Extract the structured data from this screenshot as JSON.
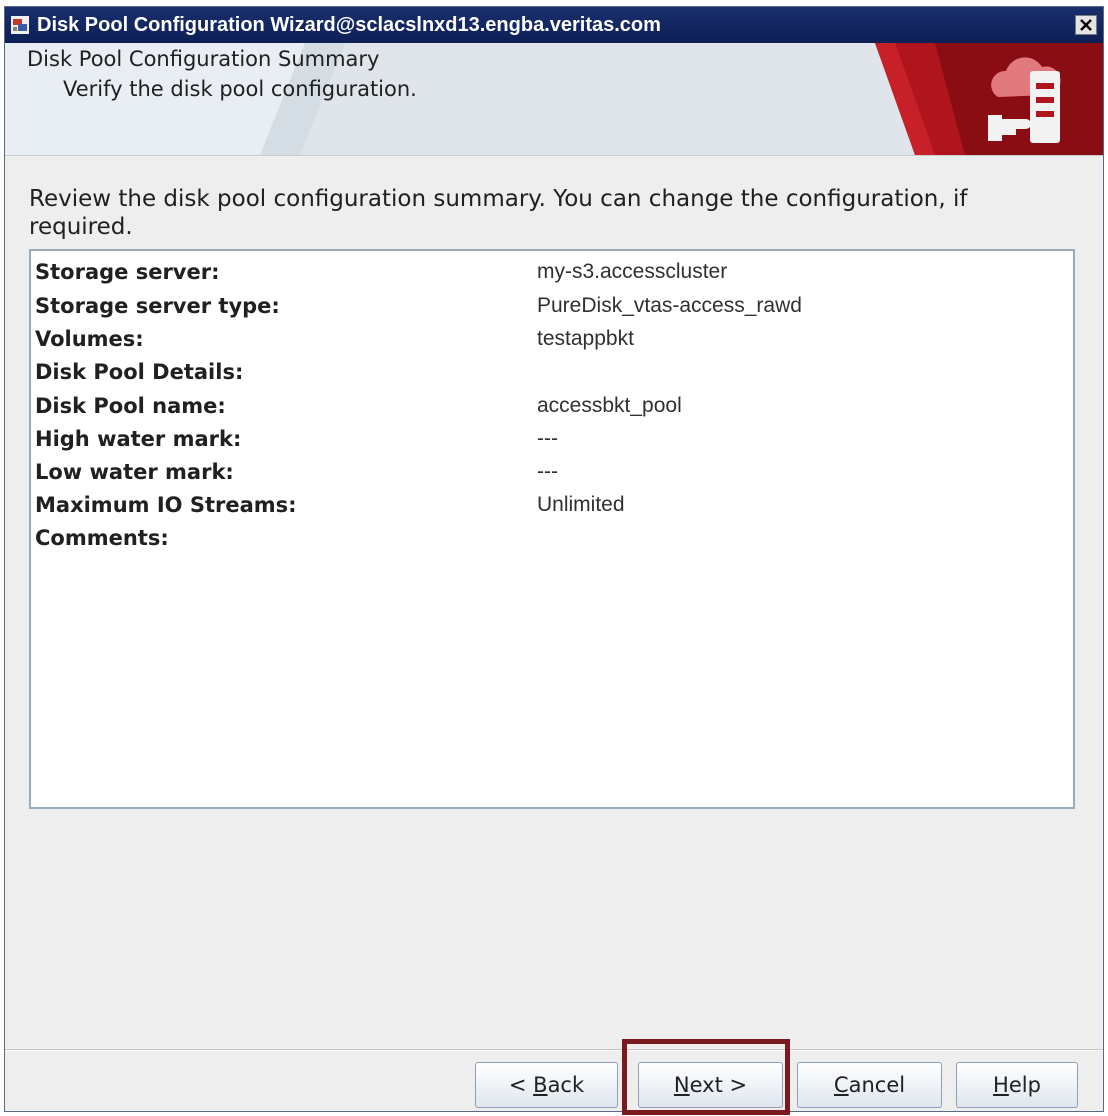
{
  "window": {
    "title": "Disk Pool Configuration Wizard@sclacslnxd13.engba.veritas.com",
    "close_glyph": "✕"
  },
  "header": {
    "title": "Disk Pool Configuration Summary",
    "subtitle": "Verify the disk pool configuration.",
    "brand_color": "#b0141c",
    "logo_icon": "cloud-storage-icon"
  },
  "instructions": "Review the disk pool configuration summary. You can change the configuration, if required.",
  "summary": {
    "rows": [
      {
        "label": "Storage server:",
        "value": "my-s3.accesscluster"
      },
      {
        "label": "Storage server type:",
        "value": "PureDisk_vtas-access_rawd"
      },
      {
        "label": "Volumes:",
        "value": "testappbkt"
      },
      {
        "label": "Disk Pool Details:",
        "value": ""
      },
      {
        "label": "Disk Pool name:",
        "value": "accessbkt_pool"
      },
      {
        "label": "High water mark:",
        "value": "---"
      },
      {
        "label": "Low water mark:",
        "value": "---"
      },
      {
        "label": "Maximum IO Streams:",
        "value": "Unlimited"
      },
      {
        "label": "Comments:",
        "value": ""
      }
    ]
  },
  "buttons": {
    "back": {
      "prefix": "< ",
      "mnemonic": "B",
      "rest": "ack"
    },
    "next": {
      "mnemonic": "N",
      "rest": "ext >"
    },
    "cancel": {
      "mnemonic": "C",
      "rest": "ancel"
    },
    "help": {
      "mnemonic": "H",
      "rest": "elp"
    }
  },
  "highlight_color": "#7a1a1f"
}
